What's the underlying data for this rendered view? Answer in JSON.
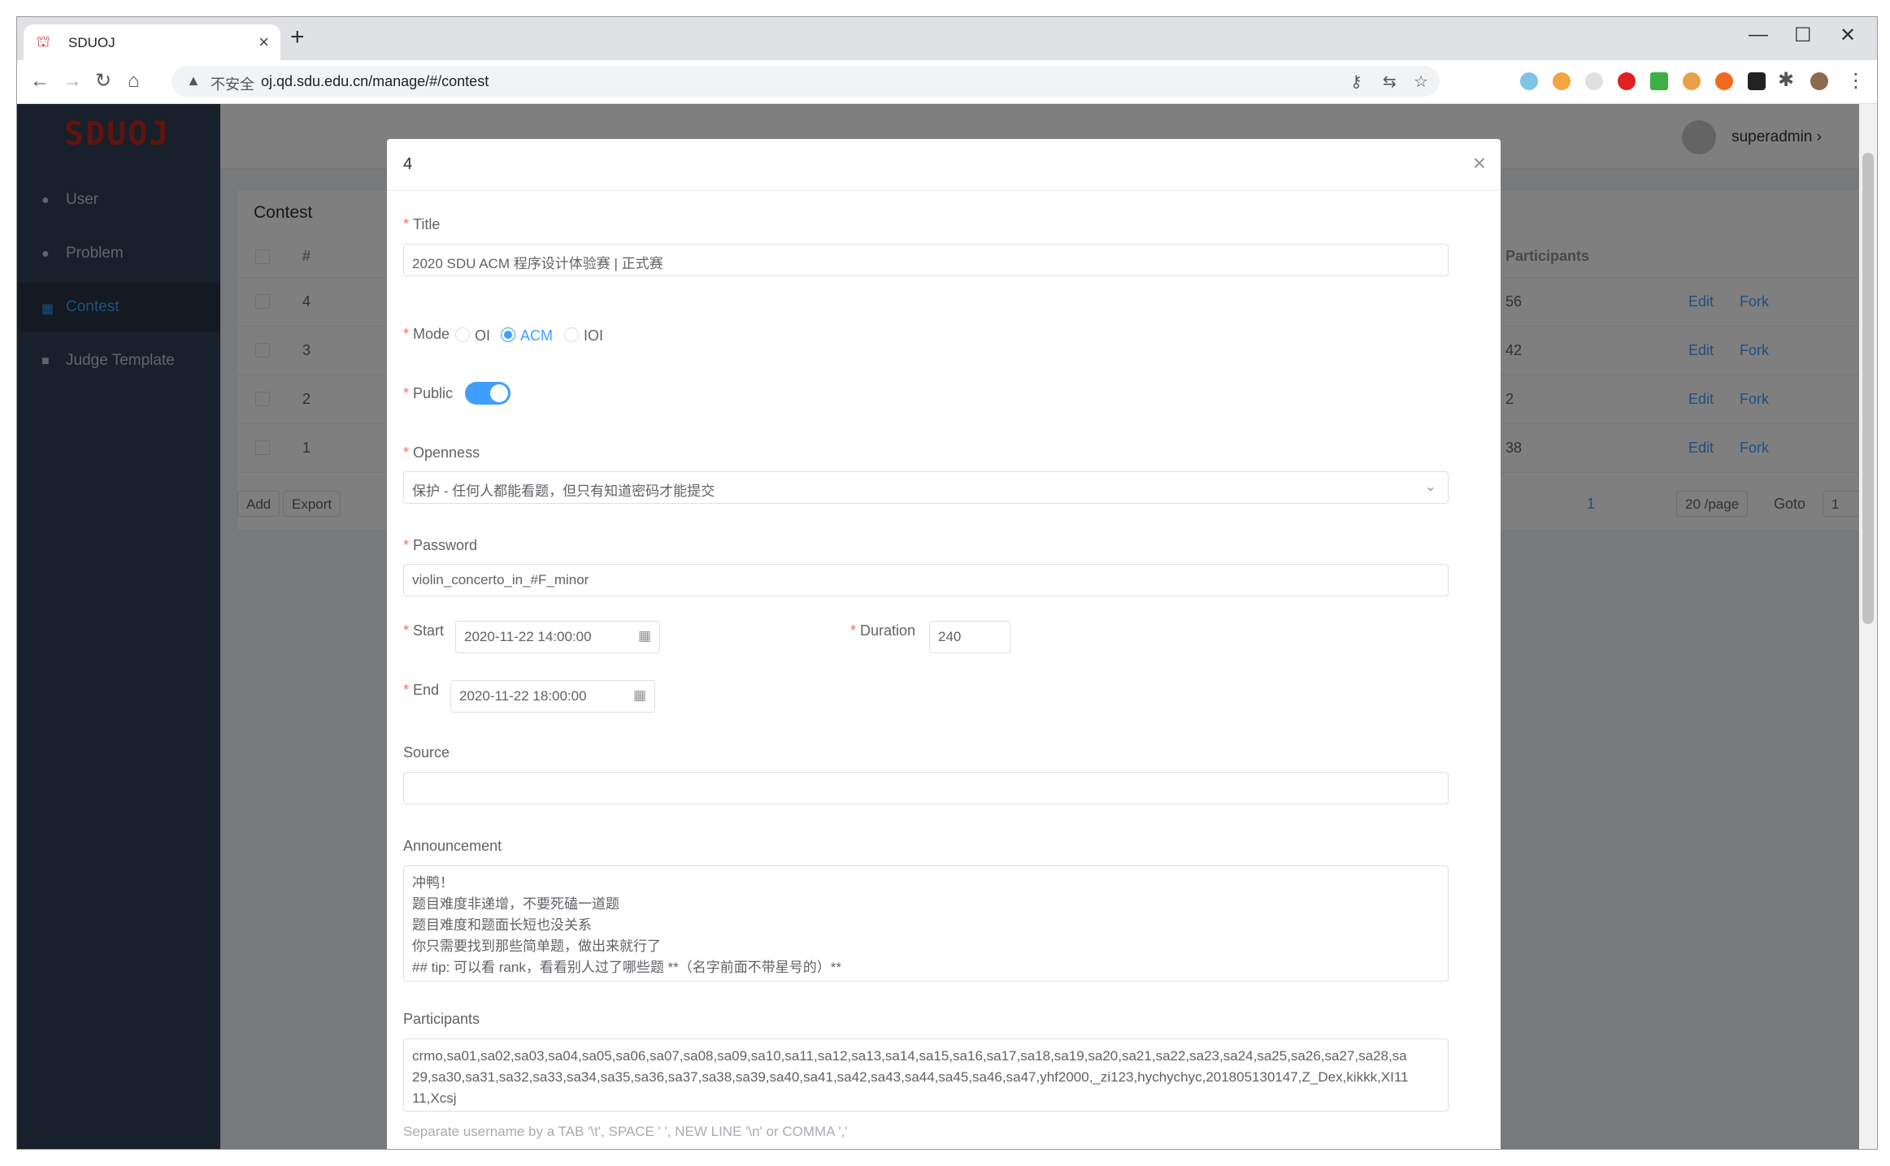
{
  "browser": {
    "tab_title": "SDUOJ",
    "insecure_label": "不安全",
    "url": "oj.qd.sdu.edu.cn/manage/#/contest"
  },
  "sidebar": {
    "logo": "SDUOJ",
    "items": [
      {
        "label": "User",
        "icon": "user-icon"
      },
      {
        "label": "Problem",
        "icon": "problem-icon"
      },
      {
        "label": "Contest",
        "icon": "grid-icon",
        "active": true
      },
      {
        "label": "Judge Template",
        "icon": "template-icon"
      }
    ]
  },
  "header": {
    "username": "superadmin",
    "chevron": "›"
  },
  "list": {
    "title": "Contest",
    "col_id": "#",
    "col_participants": "Participants",
    "rows": [
      {
        "id": "4",
        "participants": "56",
        "edit": "Edit",
        "fork": "Fork"
      },
      {
        "id": "3",
        "participants": "42",
        "edit": "Edit",
        "fork": "Fork"
      },
      {
        "id": "2",
        "participants": "2",
        "edit": "Edit",
        "fork": "Fork"
      },
      {
        "id": "1",
        "participants": "38",
        "edit": "Edit",
        "fork": "Fork"
      }
    ],
    "add": "Add",
    "export": "Export",
    "page": "1",
    "page_size": "20 /page",
    "goto": "Goto",
    "goto_value": "1"
  },
  "modal": {
    "title": "4",
    "title_label": "Title",
    "title_value": "2020 SDU ACM 程序设计体验赛 | 正式赛",
    "mode_label": "Mode",
    "modes": [
      "OI",
      "ACM",
      "IOI"
    ],
    "mode_selected": "ACM",
    "public_label": "Public",
    "public_on": true,
    "openness_label": "Openness",
    "openness_value": "保护 - 任何人都能看题，但只有知道密码才能提交",
    "password_label": "Password",
    "password_value": "violin_concerto_in_#F_minor",
    "start_label": "Start",
    "start_value": "2020-11-22 14:00:00",
    "duration_label": "Duration",
    "duration_value": "240",
    "end_label": "End",
    "end_value": "2020-11-22 18:00:00",
    "source_label": "Source",
    "source_value": "",
    "announcement_label": "Announcement",
    "announcement_lines": [
      "冲鸭！",
      "题目难度非递增，不要死磕一道题",
      "题目难度和题面长短也没关系",
      "你只需要找到那些简单题，做出来就行了",
      "## tip: 可以看 rank，看看别人过了哪些题 **（名字前面不带星号的）**"
    ],
    "participants_label": "Participants",
    "participants_lines": [
      "crmo,sa01,sa02,sa03,sa04,sa05,sa06,sa07,sa08,sa09,sa10,sa11,sa12,sa13,sa14,sa15,sa16,sa17,sa18,sa19,sa20,sa21,sa22,sa23,sa24,sa25,sa26,sa27,sa28,sa",
      "29,sa30,sa31,sa32,sa33,sa34,sa35,sa36,sa37,sa38,sa39,sa40,sa41,sa42,sa43,sa44,sa45,sa46,sa47,yhf2000,_zi123,hychychyc,201805130147,Z_Dex,kikkk,XI11",
      "11,Xcsj"
    ],
    "participants_hint": "Separate username by a TAB '\\t', SPACE ' ', NEW LINE '\\n' or COMMA ','"
  }
}
